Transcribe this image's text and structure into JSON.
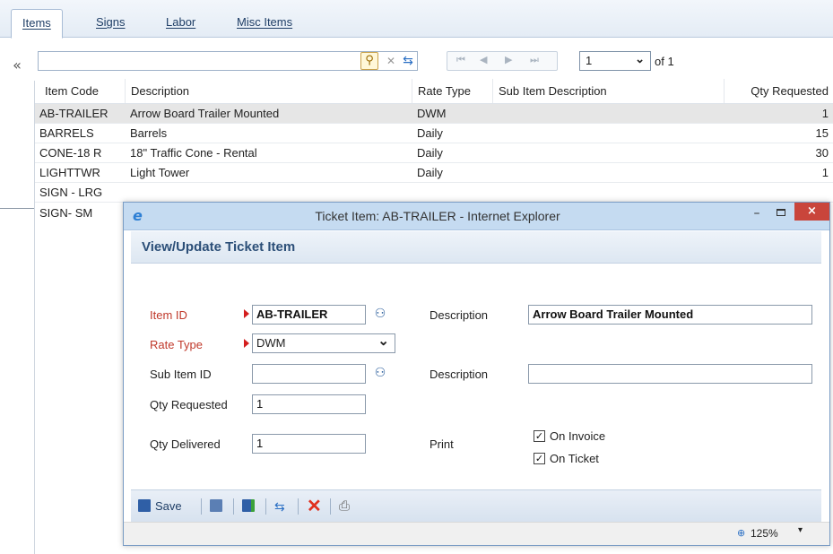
{
  "tabs": [
    {
      "label": "Items",
      "active": true
    },
    {
      "label": "Signs",
      "active": false
    },
    {
      "label": "Labor",
      "active": false
    },
    {
      "label": "Misc Items",
      "active": false
    }
  ],
  "toolbar": {
    "collapse_icon": "double-chevron-left-icon",
    "filter_value": "",
    "search_icon": "magnifier-icon",
    "clear_icon": "x-icon",
    "refresh_icon": "refresh-arrows-icon",
    "page_current": "1",
    "page_of": "of 1"
  },
  "grid": {
    "columns": [
      "Item Code",
      "Description",
      "Rate Type",
      "Sub Item Description",
      "Qty Requested"
    ],
    "rows": [
      {
        "code": "AB-TRAILER",
        "description": "Arrow Board Trailer Mounted",
        "rate_type": "DWM",
        "sub_item": "",
        "qty": "1"
      },
      {
        "code": "BARRELS",
        "description": "Barrels",
        "rate_type": "Daily",
        "sub_item": "",
        "qty": "15"
      },
      {
        "code": "CONE-18 R",
        "description": "18\" Traffic Cone - Rental",
        "rate_type": "Daily",
        "sub_item": "",
        "qty": "30"
      },
      {
        "code": "LIGHTTWR",
        "description": "Light Tower",
        "rate_type": "Daily",
        "sub_item": "",
        "qty": "1"
      },
      {
        "code": "SIGN - LRG",
        "description": "",
        "rate_type": "",
        "sub_item": "",
        "qty": ""
      },
      {
        "code": "SIGN- SM",
        "description": "",
        "rate_type": "",
        "sub_item": "",
        "qty": ""
      }
    ]
  },
  "popup": {
    "title": "Ticket Item: AB-TRAILER - Internet Explorer",
    "header": "View/Update Ticket Item",
    "close_label": "×",
    "min_label": "–",
    "form": {
      "item_id_label": "Item ID",
      "item_id_value": "AB-TRAILER",
      "description_label": "Description",
      "description_value": "Arrow Board Trailer Mounted",
      "rate_type_label": "Rate Type",
      "rate_type_value": "DWM",
      "sub_item_id_label": "Sub Item ID",
      "sub_item_id_value": "",
      "sub_description_label": "Description",
      "sub_description_value": "",
      "qty_requested_label": "Qty Requested",
      "qty_requested_value": "1",
      "qty_delivered_label": "Qty Delivered",
      "qty_delivered_value": "1",
      "print_label": "Print",
      "on_invoice_label": "On Invoice",
      "on_invoice_checked": true,
      "on_ticket_label": "On Ticket",
      "on_ticket_checked": true
    },
    "toolbar": {
      "save_label": "Save"
    },
    "status": {
      "zoom": "125%"
    }
  }
}
